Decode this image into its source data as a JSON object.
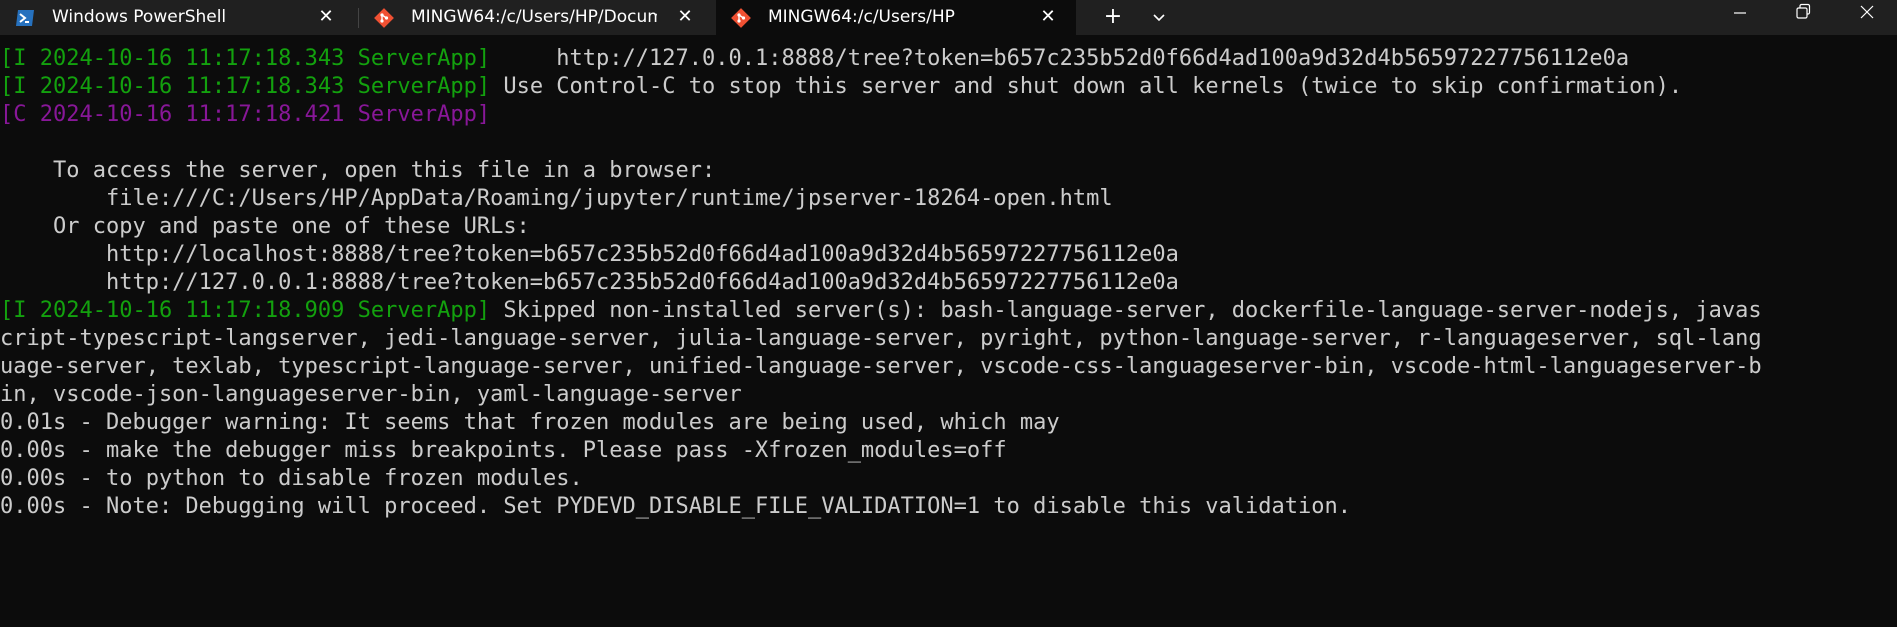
{
  "tabs": [
    {
      "label": "Windows PowerShell",
      "icon": "powershell-icon",
      "active": false
    },
    {
      "label": "MINGW64:/c/Users/HP/Docum",
      "icon": "git-icon",
      "active": false
    },
    {
      "label": "MINGW64:/c/Users/HP",
      "icon": "git-icon",
      "active": true
    }
  ],
  "tabstrip": {
    "new_tab": "+",
    "dropdown": "⌄",
    "minimize": "—",
    "maximize": "❐",
    "close": "✕"
  },
  "terminal": {
    "lines": [
      {
        "prefix": "[I 2024-10-16 11:17:18.343 ServerApp]",
        "text": "     http://127.0.0.1:8888/tree?token=b657c235b52d0f66d4ad100a9d32d4b56597227756112e0a"
      },
      {
        "prefix": "[I 2024-10-16 11:17:18.343 ServerApp]",
        "text": " Use Control-C to stop this server and shut down all kernels (twice to skip confirmation)."
      },
      {
        "prefix": "[C 2024-10-16 11:17:18.421 ServerApp]",
        "text": ""
      },
      {
        "prefix": "",
        "text": ""
      },
      {
        "prefix": "",
        "text": "    To access the server, open this file in a browser:"
      },
      {
        "prefix": "",
        "text": "        file:///C:/Users/HP/AppData/Roaming/jupyter/runtime/jpserver-18264-open.html"
      },
      {
        "prefix": "",
        "text": "    Or copy and paste one of these URLs:"
      },
      {
        "prefix": "",
        "text": "        http://localhost:8888/tree?token=b657c235b52d0f66d4ad100a9d32d4b56597227756112e0a"
      },
      {
        "prefix": "",
        "text": "        http://127.0.0.1:8888/tree?token=b657c235b52d0f66d4ad100a9d32d4b56597227756112e0a"
      },
      {
        "prefix": "[I 2024-10-16 11:17:18.909 ServerApp]",
        "text": " Skipped non-installed server(s): bash-language-server, dockerfile-language-server-nodejs, javas"
      },
      {
        "prefix": "",
        "text": "cript-typescript-langserver, jedi-language-server, julia-language-server, pyright, python-language-server, r-languageserver, sql-lang"
      },
      {
        "prefix": "",
        "text": "uage-server, texlab, typescript-language-server, unified-language-server, vscode-css-languageserver-bin, vscode-html-languageserver-b"
      },
      {
        "prefix": "",
        "text": "in, vscode-json-languageserver-bin, yaml-language-server"
      },
      {
        "prefix": "",
        "text": "0.01s - Debugger warning: It seems that frozen modules are being used, which may"
      },
      {
        "prefix": "",
        "text": "0.00s - make the debugger miss breakpoints. Please pass -Xfrozen_modules=off"
      },
      {
        "prefix": "",
        "text": "0.00s - to python to disable frozen modules."
      },
      {
        "prefix": "",
        "text": "0.00s - Note: Debugging will proceed. Set PYDEVD_DISABLE_FILE_VALIDATION=1 to disable this validation."
      }
    ]
  },
  "colors": {
    "background": "#0c0c0c",
    "tabstrip": "#202020",
    "text": "#cccccc",
    "log_info": "#13a10e",
    "log_critical": "#881798",
    "powershell_icon": "#2671be",
    "git_icon": "#f05133"
  }
}
